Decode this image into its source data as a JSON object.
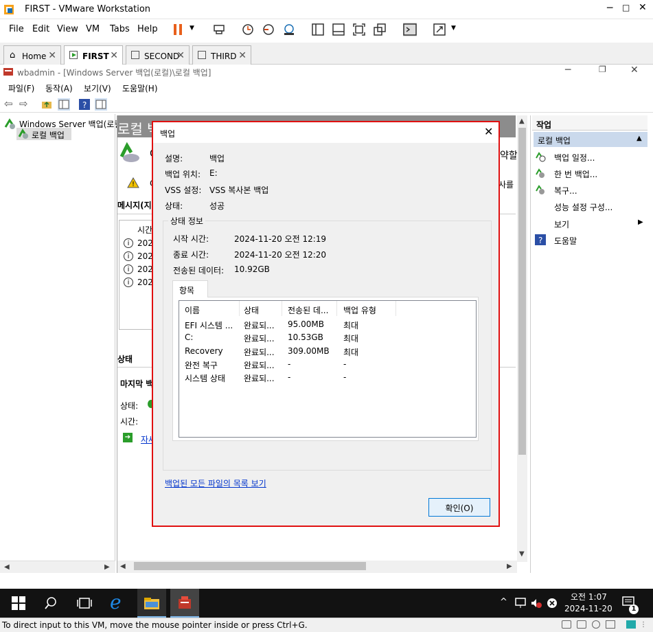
{
  "vmware": {
    "title": "FIRST - VMware Workstation",
    "menu": [
      "File",
      "Edit",
      "View",
      "VM",
      "Tabs",
      "Help"
    ],
    "tabs": [
      {
        "label": "Home"
      },
      {
        "label": "FIRST"
      },
      {
        "label": "SECOND"
      },
      {
        "label": "THIRD"
      }
    ],
    "status": "To direct input to this VM, move the mouse pointer inside or press Ctrl+G."
  },
  "mmc": {
    "title": "wbadmin - [Windows Server 백업(로컬)\\로컬 백업]",
    "menu": [
      "파일(F)",
      "동작(A)",
      "보기(V)",
      "도움말(H)"
    ]
  },
  "tree": {
    "root": "Windows Server 백업(로컬)",
    "child": "로컬 백업"
  },
  "center": {
    "banner": "로컬 백",
    "banner_right": "약할",
    "warn_right": "사를",
    "messages_header": "메시지(지",
    "col_time": "시간",
    "rows": [
      "202",
      "202",
      "202",
      "202"
    ],
    "status_header": "상태",
    "last_backup": "마지막 백",
    "state_label": "상태:",
    "time_label": "시간:",
    "detail_link": "자세"
  },
  "actions": {
    "header": "작업",
    "section": "로컬 백업",
    "items": [
      "백업 일정...",
      "한 번 백업...",
      "복구...",
      "성능 설정 구성...",
      "보기",
      "도움말"
    ]
  },
  "dialog": {
    "title": "백업",
    "fields": [
      {
        "label": "설명:",
        "value": "백업"
      },
      {
        "label": "백업 위치:",
        "value": "E:"
      },
      {
        "label": "VSS 설정:",
        "value": "VSS 복사본 백업"
      },
      {
        "label": "상태:",
        "value": "성공"
      }
    ],
    "group_title": "상태 정보",
    "info": [
      {
        "label": "시작 시간:",
        "value": "2024-11-20 오전 12:19"
      },
      {
        "label": "종료 시간:",
        "value": "2024-11-20 오전 12:20"
      },
      {
        "label": "전송된 데이터:",
        "value": "10.92GB"
      }
    ],
    "tab": "항목",
    "columns": [
      "이름",
      "상태",
      "전송된 데...",
      "백업 유형"
    ],
    "rows": [
      [
        "EFI 시스템 ...",
        "완료되...",
        "95.00MB",
        "최대"
      ],
      [
        "C:",
        "완료되...",
        "10.53GB",
        "최대"
      ],
      [
        "Recovery",
        "완료되...",
        "309.00MB",
        "최대"
      ],
      [
        "완전 복구",
        "완료되...",
        "-",
        "-"
      ],
      [
        "시스템 상태",
        "완료되...",
        "-",
        "-"
      ]
    ],
    "link": "백업된 모든 파일의 목록 보기",
    "ok": "확인(O)"
  },
  "clock": {
    "time": "오전 1:07",
    "date": "2024-11-20"
  },
  "notif_count": "1",
  "colors": {
    "accent": "#0078d7",
    "highlight_border": "#e01010",
    "taskbar": "#121212"
  }
}
